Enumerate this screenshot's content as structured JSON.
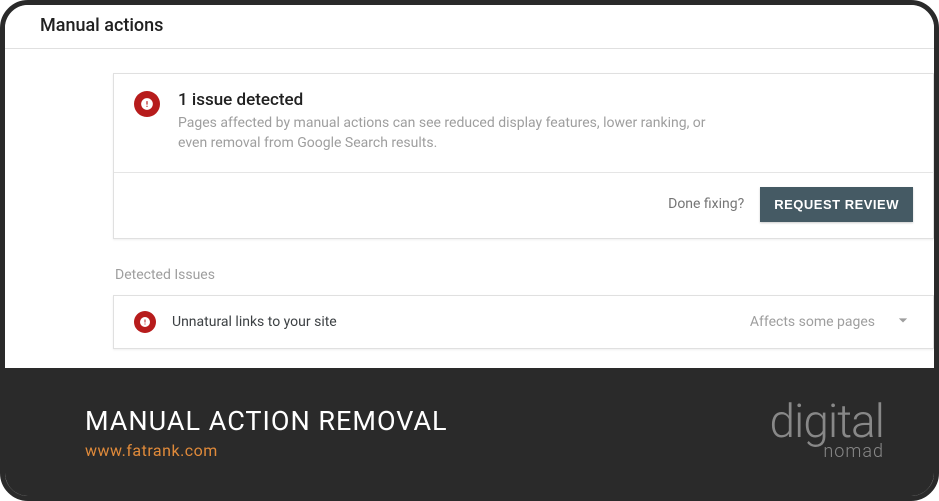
{
  "header": {
    "title": "Manual actions"
  },
  "alertCard": {
    "title": "1 issue detected",
    "description": "Pages affected by manual actions can see reduced display features, lower ranking, or even removal from Google Search results."
  },
  "footer": {
    "doneFixing": "Done fixing?",
    "requestReview": "REQUEST REVIEW"
  },
  "sectionHeading": "Detected Issues",
  "issues": {
    "row0": {
      "name": "Unnatural links to your site",
      "scope": "Affects some pages"
    }
  },
  "banner": {
    "title": "MANUAL ACTION REMOVAL",
    "url": "www.fatrank.com",
    "logoMain": "digital",
    "logoSub": "nomad"
  }
}
